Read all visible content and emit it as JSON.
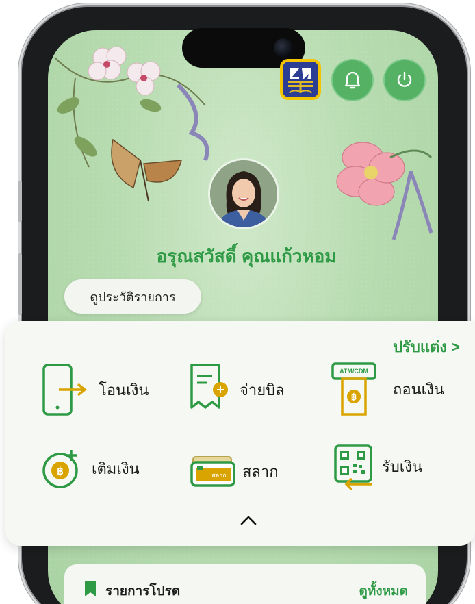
{
  "header": {
    "logo_icon": "gsb-bank-logo-icon",
    "notification_icon": "bell-icon",
    "logout_icon": "power-icon"
  },
  "profile": {
    "greeting": "อรุณสวัสดิ์ คุณแก้วหอม",
    "history_button": "ดูประวัติรายการ"
  },
  "menu": {
    "customize_label": "ปรับแต่ง >",
    "items": [
      {
        "label": "โอนเงิน",
        "icon": "transfer-phone-icon"
      },
      {
        "label": "จ่ายบิล",
        "icon": "bill-payment-icon"
      },
      {
        "label": "ถอนเงิน",
        "icon": "atm-withdraw-icon",
        "badge": "ATM/CDM"
      },
      {
        "label": "เติมเงิน",
        "icon": "topup-coin-icon"
      },
      {
        "label": "สลาก",
        "icon": "lottery-card-icon",
        "card_text": "สลาก"
      },
      {
        "label": "รับเงิน",
        "icon": "qr-receive-icon"
      }
    ],
    "collapse_icon": "chevron-up-icon"
  },
  "favorites": {
    "title": "รายการโปรด",
    "see_all": "ดูทั้งหมด"
  },
  "colors": {
    "brand_green": "#2e9a45",
    "accent_gold": "#d9a400",
    "background_green": "#b8dcb1"
  }
}
